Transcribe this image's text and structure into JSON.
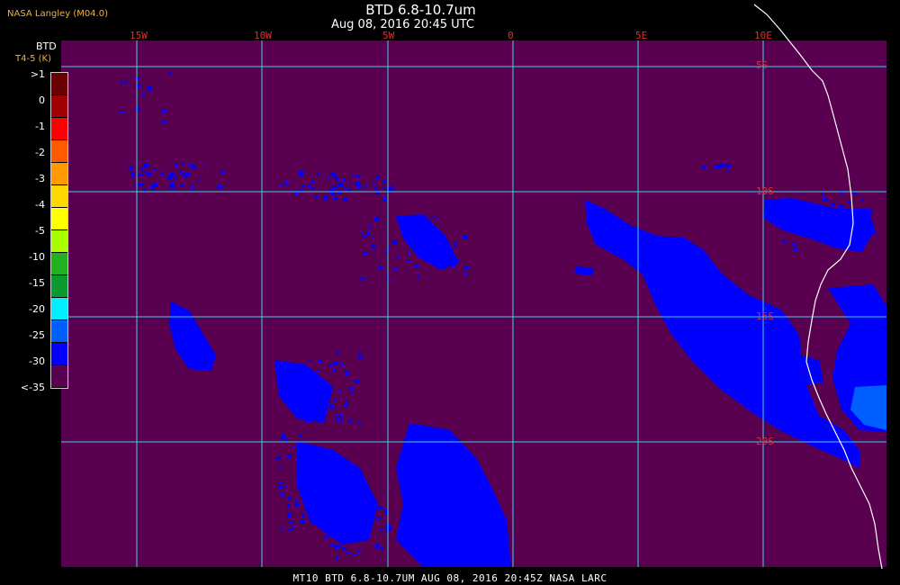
{
  "header": {
    "source": "NASA Langley (M04.0)",
    "title": "BTD 6.8-10.7um",
    "timestamp": "Aug 08, 2016 20:45 UTC"
  },
  "legend": {
    "title": "BTD",
    "subtitle": "T4-5 (K)",
    "ticks": [
      ">1",
      "0",
      "-1",
      "-2",
      "-3",
      "-4",
      "-5",
      "-10",
      "-15",
      "-20",
      "-25",
      "-30",
      "<-35"
    ],
    "colors": [
      "#6b0000",
      "#a00000",
      "#ff0000",
      "#ff5a00",
      "#ff9a00",
      "#ffd800",
      "#ffff00",
      "#a8ff00",
      "#22b020",
      "#0a9a30",
      "#12c080",
      "#00f0ff",
      "#0060ff",
      "#0000ff",
      "#5a0050"
    ]
  },
  "map": {
    "background_color": "#5a0050",
    "grid_color": "#40d0e8",
    "coast_color": "#ffffff",
    "cloud_color": "#0000ff",
    "lon_labels": [
      "15W",
      "10W",
      "5W",
      "0",
      "5E",
      "10E"
    ],
    "lat_labels": [
      "5S",
      "10S",
      "15S",
      "20S"
    ]
  },
  "footer": {
    "caption": "MT10  BTD 6.8-10.7UM   AUG 08, 2016 20:45Z   NASA LARC"
  }
}
